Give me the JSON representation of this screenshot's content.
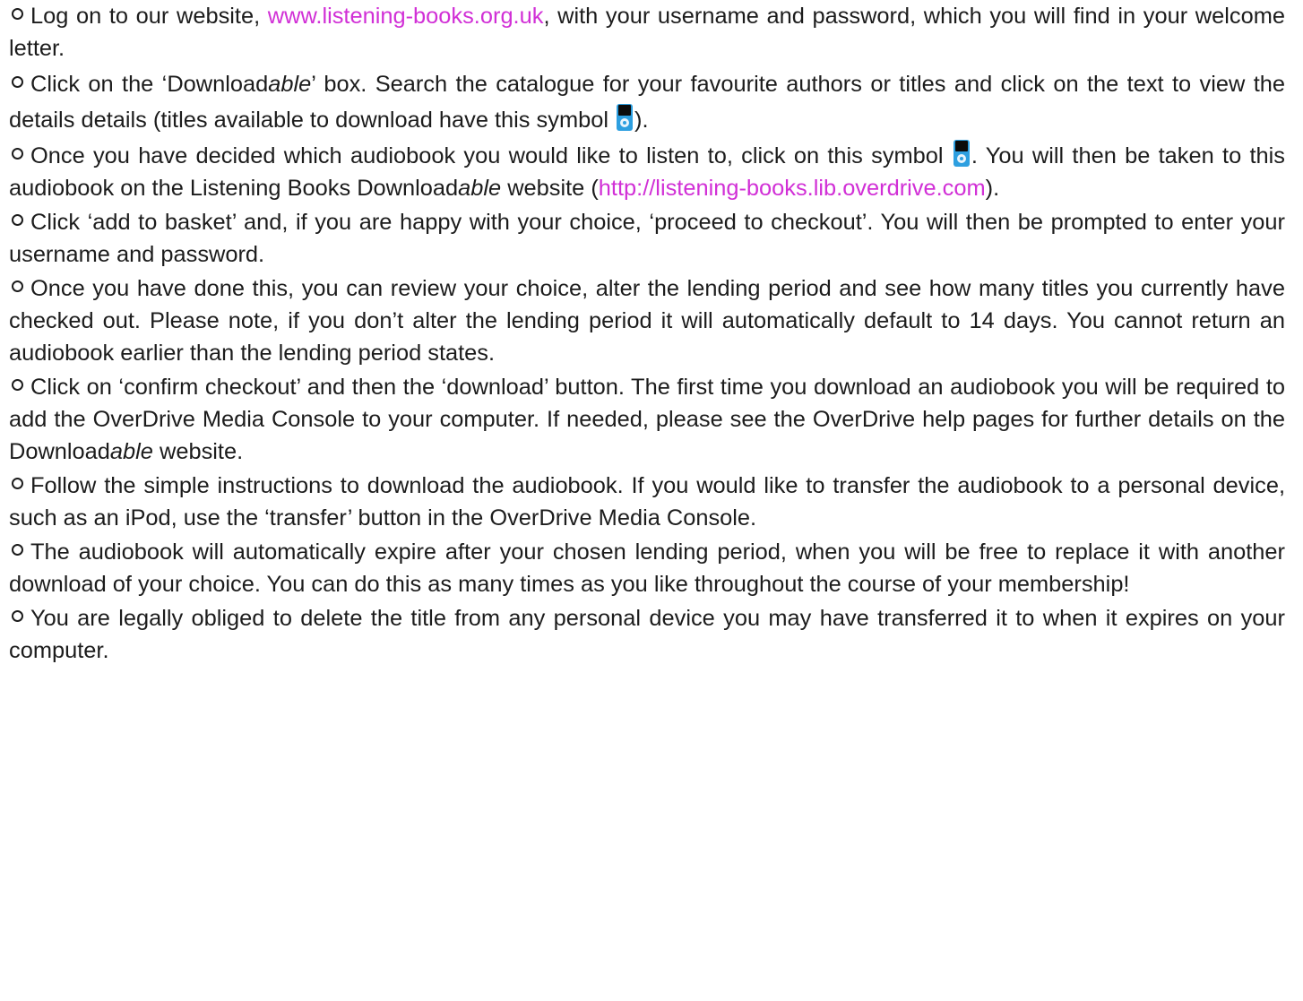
{
  "icons": {
    "bullet": "hollow-circle-bullet",
    "download_symbol": "ipod-icon"
  },
  "colors": {
    "text": "#1c1c1c",
    "link": "#d12fd6",
    "ipod_body": "#2d9fe0"
  },
  "steps": [
    {
      "t1": "Log on to our website, ",
      "link": "www.listening-books.org.uk",
      "t2": ", with your username and password, which you will find in your welcome letter."
    },
    {
      "t1": "Click on the ‘Download",
      "ital": "able",
      "t2": "’ box.  Search the catalogue for your favourite authors or titles and click on the text to view the details details (titles available to download have this symbol ",
      "t3": ")."
    },
    {
      "t1": "Once you have decided which audiobook you would like to listen to, click on this symbol ",
      "t2": ". You will then be taken to this audiobook on the Listening Books Download",
      "ital": "able",
      "t3": " website (",
      "link": "http://listening-books.lib.overdrive.com",
      "t4": ")."
    },
    {
      "text": "Click ‘add to basket’ and, if you are happy with your choice, ‘proceed to checkout’.  You will then be prompted to enter your username and password."
    },
    {
      "text": "Once you have done this, you can review your choice, alter the lending period and see how many titles you currently have checked out. Please note, if you don’t alter the lending period it will automatically default to 14 days.  You cannot return an audiobook earlier than the lending period states."
    },
    {
      "t1": "Click on ‘confirm checkout’ and then the ‘download’ button.  The first time you download an audiobook you will be required to add the OverDrive Media Console to your computer.  If needed, please see the OverDrive help pages for further details on the Download",
      "ital": "able",
      "t2": " website."
    },
    {
      "text": "Follow the simple instructions to download the audiobook.  If you would like to transfer the audiobook to a personal device, such as an iPod, use the ‘transfer’ button in the OverDrive Media Console."
    },
    {
      "text": "The audiobook will automatically expire after your chosen lending period, when you will be free to replace it with another download of your choice.  You can do this as many times as you like throughout the course of your membership!"
    },
    {
      "text": "You are legally obliged to delete the title from any personal device you may have transferred it to when it expires on your computer."
    }
  ]
}
